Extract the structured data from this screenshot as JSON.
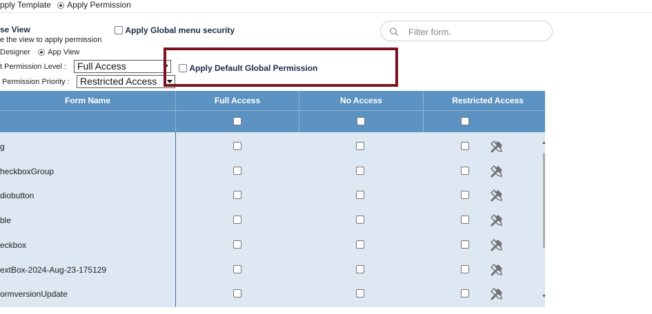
{
  "top": {
    "apply_template_label": "pply Template",
    "apply_permission_label": "Apply Permission"
  },
  "view_section": {
    "title": "se View",
    "subtitle": "e the view to apply permission",
    "designer_label": "Designer",
    "app_view_label": "App View"
  },
  "global_menu_security_label": "Apply Global menu security",
  "permission_level": {
    "label": "t Permission Level :",
    "value": "Full Access"
  },
  "permission_priority": {
    "label": "Permission Priority :",
    "value": "Restricted Access"
  },
  "default_global_permission_label": "Apply Default Global Permission",
  "search": {
    "placeholder": "Filter form."
  },
  "table": {
    "headers": [
      "Form Name",
      "Full Access",
      "No Access",
      "Restricted Access"
    ],
    "rows": [
      {
        "name": "g"
      },
      {
        "name": "heckboxGroup"
      },
      {
        "name": "diobutton"
      },
      {
        "name": "ble"
      },
      {
        "name": "eckbox"
      },
      {
        "name": "extBox-2024-Aug-23-175129"
      },
      {
        "name": "ormversionUpdate"
      }
    ]
  },
  "colors": {
    "header_bg": "#5d93c2",
    "table_bg": "#dde8f2",
    "highlight_border": "#7a1320"
  },
  "icons": {
    "search": "search-icon",
    "tools": "tools-icon"
  }
}
